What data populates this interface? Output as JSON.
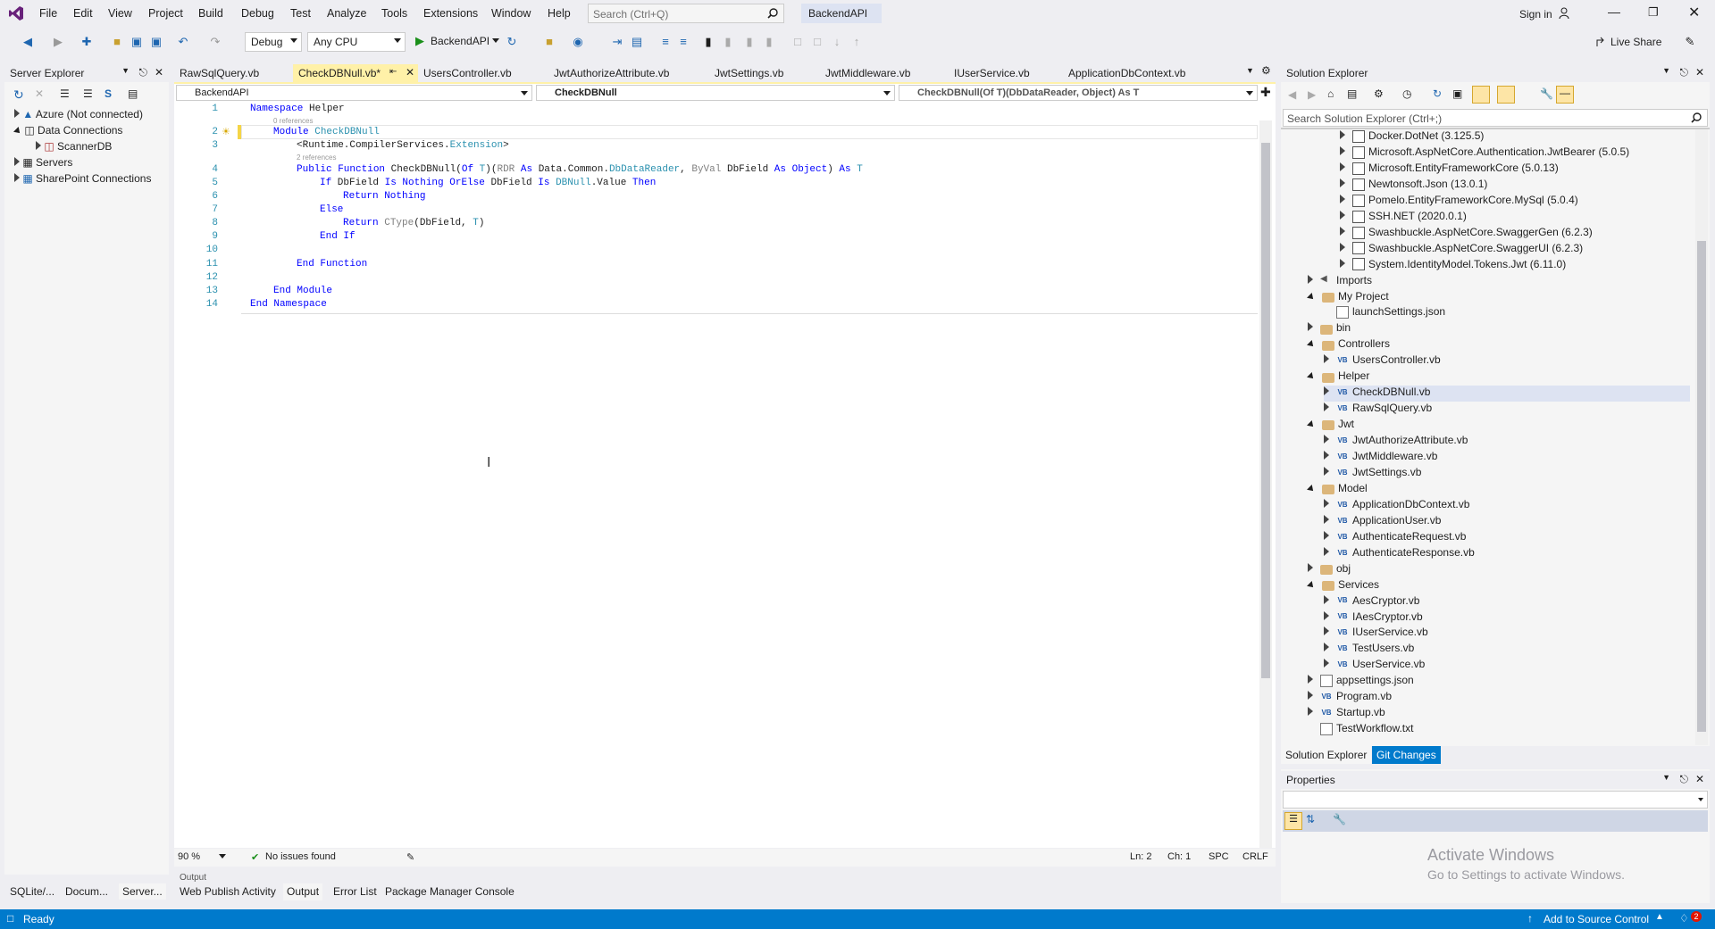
{
  "menu": [
    "File",
    "Edit",
    "View",
    "Project",
    "Build",
    "Debug",
    "Test",
    "Analyze",
    "Tools",
    "Extensions",
    "Window",
    "Help"
  ],
  "search": {
    "placeholder": "Search (Ctrl+Q)"
  },
  "project_name": "BackendAPI",
  "signin": "Sign in",
  "liveshare": "Live Share",
  "toolbar": {
    "config": "Debug",
    "platform": "Any CPU",
    "run": "BackendAPI"
  },
  "server_explorer": {
    "title": "Server Explorer",
    "items": [
      {
        "label": "Azure (Not connected)",
        "level": 0
      },
      {
        "label": "Data Connections",
        "level": 0
      },
      {
        "label": "ScannerDB",
        "level": 1
      },
      {
        "label": "Servers",
        "level": 0
      },
      {
        "label": "SharePoint Connections",
        "level": 0
      }
    ]
  },
  "tabs": [
    "RawSqlQuery.vb",
    "CheckDBNull.vb*",
    "UsersController.vb",
    "JwtAuthorizeAttribute.vb",
    "JwtSettings.vb",
    "JwtMiddleware.vb",
    "IUserService.vb",
    "ApplicationDbContext.vb"
  ],
  "nav": {
    "project": "BackendAPI",
    "type": "CheckDBNull",
    "member": "CheckDBNull(Of T)(DbDataReader, Object) As T"
  },
  "code": {
    "lines": [
      "1",
      "2",
      "3",
      "4",
      "5",
      "6",
      "7",
      "8",
      "9",
      "10",
      "11",
      "12",
      "13",
      "14"
    ],
    "refs0": "0 references",
    "refs2": "2 references"
  },
  "editor_status": {
    "zoom": "90 %",
    "issues": "No issues found",
    "ln": "Ln: 2",
    "ch": "Ch: 1",
    "spc": "SPC",
    "crlf": "CRLF"
  },
  "solution_explorer": {
    "title": "Solution Explorer",
    "search": "Search Solution Explorer (Ctrl+;)",
    "items": [
      "Docker.DotNet (3.125.5)",
      "Microsoft.AspNetCore.Authentication.JwtBearer (5.0.5)",
      "Microsoft.EntityFrameworkCore (5.0.13)",
      "Newtonsoft.Json (13.0.1)",
      "Pomelo.EntityFrameworkCore.MySql (5.0.4)",
      "SSH.NET (2020.0.1)",
      "Swashbuckle.AspNetCore.SwaggerGen (6.2.3)",
      "Swashbuckle.AspNetCore.SwaggerUI (6.2.3)",
      "System.IdentityModel.Tokens.Jwt (6.11.0)",
      "Imports",
      "My Project",
      "launchSettings.json",
      "bin",
      "Controllers",
      "UsersController.vb",
      "Helper",
      "CheckDBNull.vb",
      "RawSqlQuery.vb",
      "Jwt",
      "JwtAuthorizeAttribute.vb",
      "JwtMiddleware.vb",
      "JwtSettings.vb",
      "Model",
      "ApplicationDbContext.vb",
      "ApplicationUser.vb",
      "AuthenticateRequest.vb",
      "AuthenticateResponse.vb",
      "obj",
      "Services",
      "AesCryptor.vb",
      "IAesCryptor.vb",
      "IUserService.vb",
      "TestUsers.vb",
      "UserService.vb",
      "appsettings.json",
      "Program.vb",
      "Startup.vb",
      "TestWorkflow.txt"
    ],
    "tab1": "Solution Explorer",
    "tab2": "Git Changes"
  },
  "properties": {
    "title": "Properties"
  },
  "watermark": {
    "line1": "Activate Windows",
    "line2": "Go to Settings to activate Windows."
  },
  "bottom_left_tabs": [
    "SQLite/...",
    "Docum...",
    "Server..."
  ],
  "output": {
    "title": "Output",
    "tabs": [
      "Web Publish Activity",
      "Output",
      "Error List",
      "Package Manager Console"
    ]
  },
  "status": {
    "ready": "Ready",
    "source": "Add to Source Control",
    "badge": "2"
  }
}
